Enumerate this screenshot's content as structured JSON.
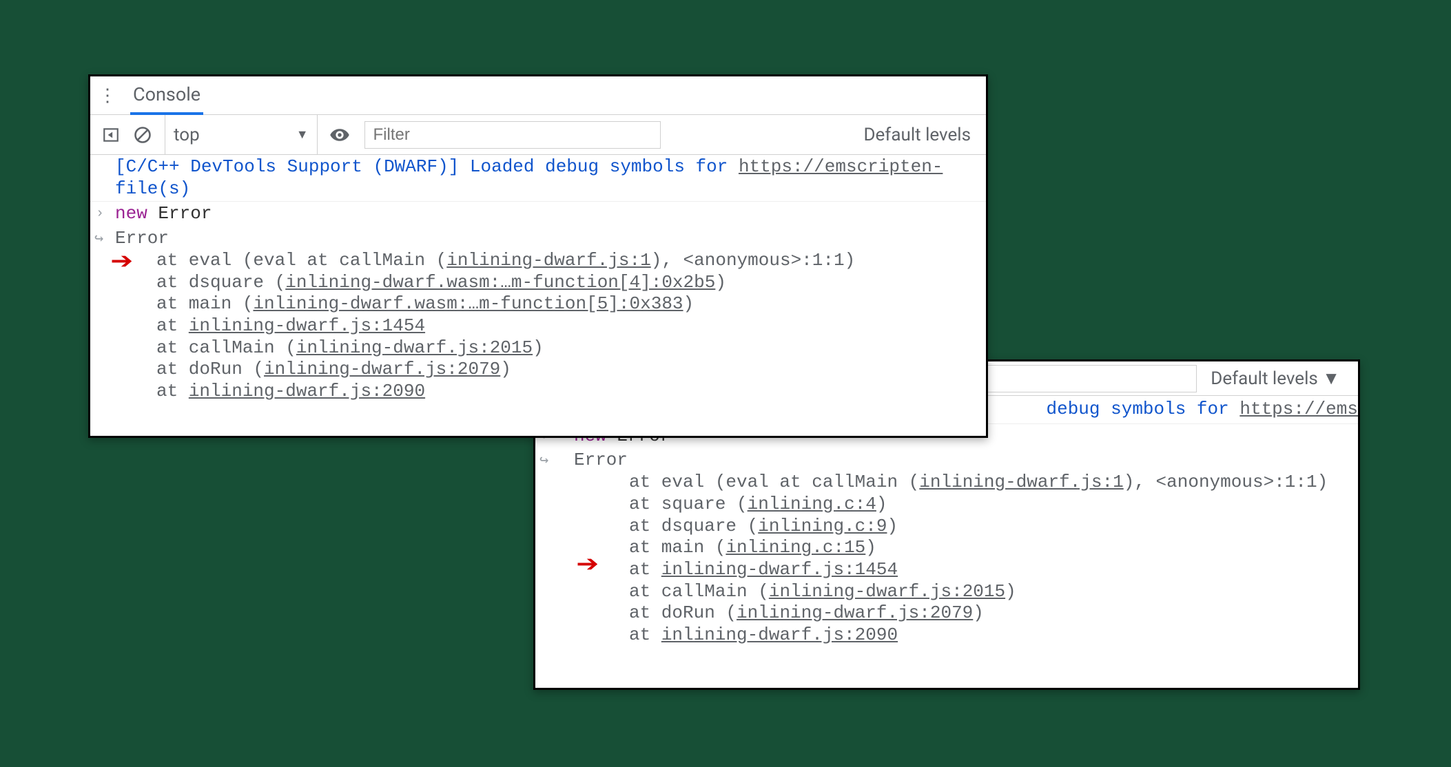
{
  "panel1": {
    "tab_label": "Console",
    "context": "top",
    "filter_placeholder": "Filter",
    "levels_label": "Default levels",
    "info_prefix": "[C/C++ DevTools Support (DWARF)] Loaded debug symbols for ",
    "info_link": "https://emscripten-",
    "info_suffix": "file(s)",
    "input_kw": "new",
    "input_rest": " Error",
    "error_head": "Error",
    "stack": [
      {
        "pre": "at eval (eval at callMain (",
        "link": "inlining-dwarf.js:1",
        "post": "), <anonymous>:1:1)"
      },
      {
        "pre": "at dsquare (",
        "link": "inlining-dwarf.wasm:…m-function[4]:0x2b5",
        "post": ")"
      },
      {
        "pre": "at main (",
        "link": "inlining-dwarf.wasm:…m-function[5]:0x383",
        "post": ")"
      },
      {
        "pre": "at ",
        "link": "inlining-dwarf.js:1454",
        "post": ""
      },
      {
        "pre": "at callMain (",
        "link": "inlining-dwarf.js:2015",
        "post": ")"
      },
      {
        "pre": "at doRun (",
        "link": "inlining-dwarf.js:2079",
        "post": ")"
      },
      {
        "pre": "at ",
        "link": "inlining-dwarf.js:2090",
        "post": ""
      }
    ]
  },
  "panel2": {
    "levels_label": "Default levels ▼",
    "info_tail_pre": "debug symbols for ",
    "info_tail_link": "https://ems",
    "input_kw": "new",
    "input_rest": " Error",
    "error_head": "Error",
    "stack": [
      {
        "pre": "at eval (eval at callMain (",
        "link": "inlining-dwarf.js:1",
        "post": "), <anonymous>:1:1)"
      },
      {
        "pre": "at square (",
        "link": "inlining.c:4",
        "post": ")"
      },
      {
        "pre": "at dsquare (",
        "link": "inlining.c:9",
        "post": ")"
      },
      {
        "pre": "at main (",
        "link": "inlining.c:15",
        "post": ")"
      },
      {
        "pre": "at ",
        "link": "inlining-dwarf.js:1454",
        "post": ""
      },
      {
        "pre": "at callMain (",
        "link": "inlining-dwarf.js:2015",
        "post": ")"
      },
      {
        "pre": "at doRun (",
        "link": "inlining-dwarf.js:2079",
        "post": ")"
      },
      {
        "pre": "at ",
        "link": "inlining-dwarf.js:2090",
        "post": ""
      }
    ]
  }
}
